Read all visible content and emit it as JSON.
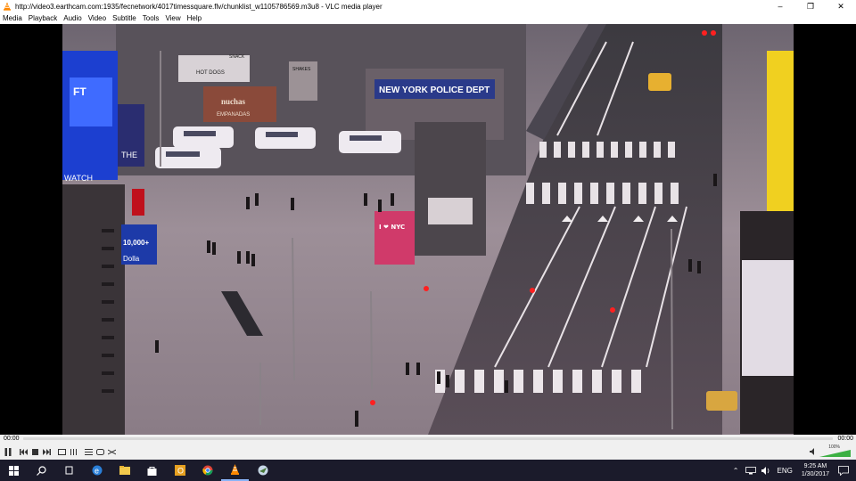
{
  "window": {
    "title": "http://video3.earthcam.com:1935/fecnetwork/4017timessquare.flv/chunklist_w1105786569.m3u8 - VLC media player",
    "minimize": "–",
    "maximize": "❐",
    "close": "✕"
  },
  "menu": [
    "Media",
    "Playback",
    "Audio",
    "Video",
    "Subtitle",
    "Tools",
    "View",
    "Help"
  ],
  "video": {
    "signs": {
      "ny_dept": "NEW YORK POLICE DEPT",
      "nuchas": "nuchas",
      "empanadas": "EMPANADAS",
      "hot_dogs": "HOT DOGS",
      "snack": "SNACK",
      "shakes": "SHAKES",
      "i_nyc": "I ❤ NYC",
      "watch": "WATCH",
      "the": "THE",
      "ten_thousand": "10,000+",
      "dollar": "Dolla"
    }
  },
  "player": {
    "elapsed": "00:00",
    "total": "00:00",
    "volume": "100%",
    "progress": 0
  },
  "taskbar": {
    "lang": "ENG",
    "time": "9:25 AM",
    "date": "1/30/2017"
  },
  "colors": {
    "vlc_orange": "#ff8800",
    "taskbar": "#1b1b2b",
    "volume_green": "#3cb043"
  }
}
